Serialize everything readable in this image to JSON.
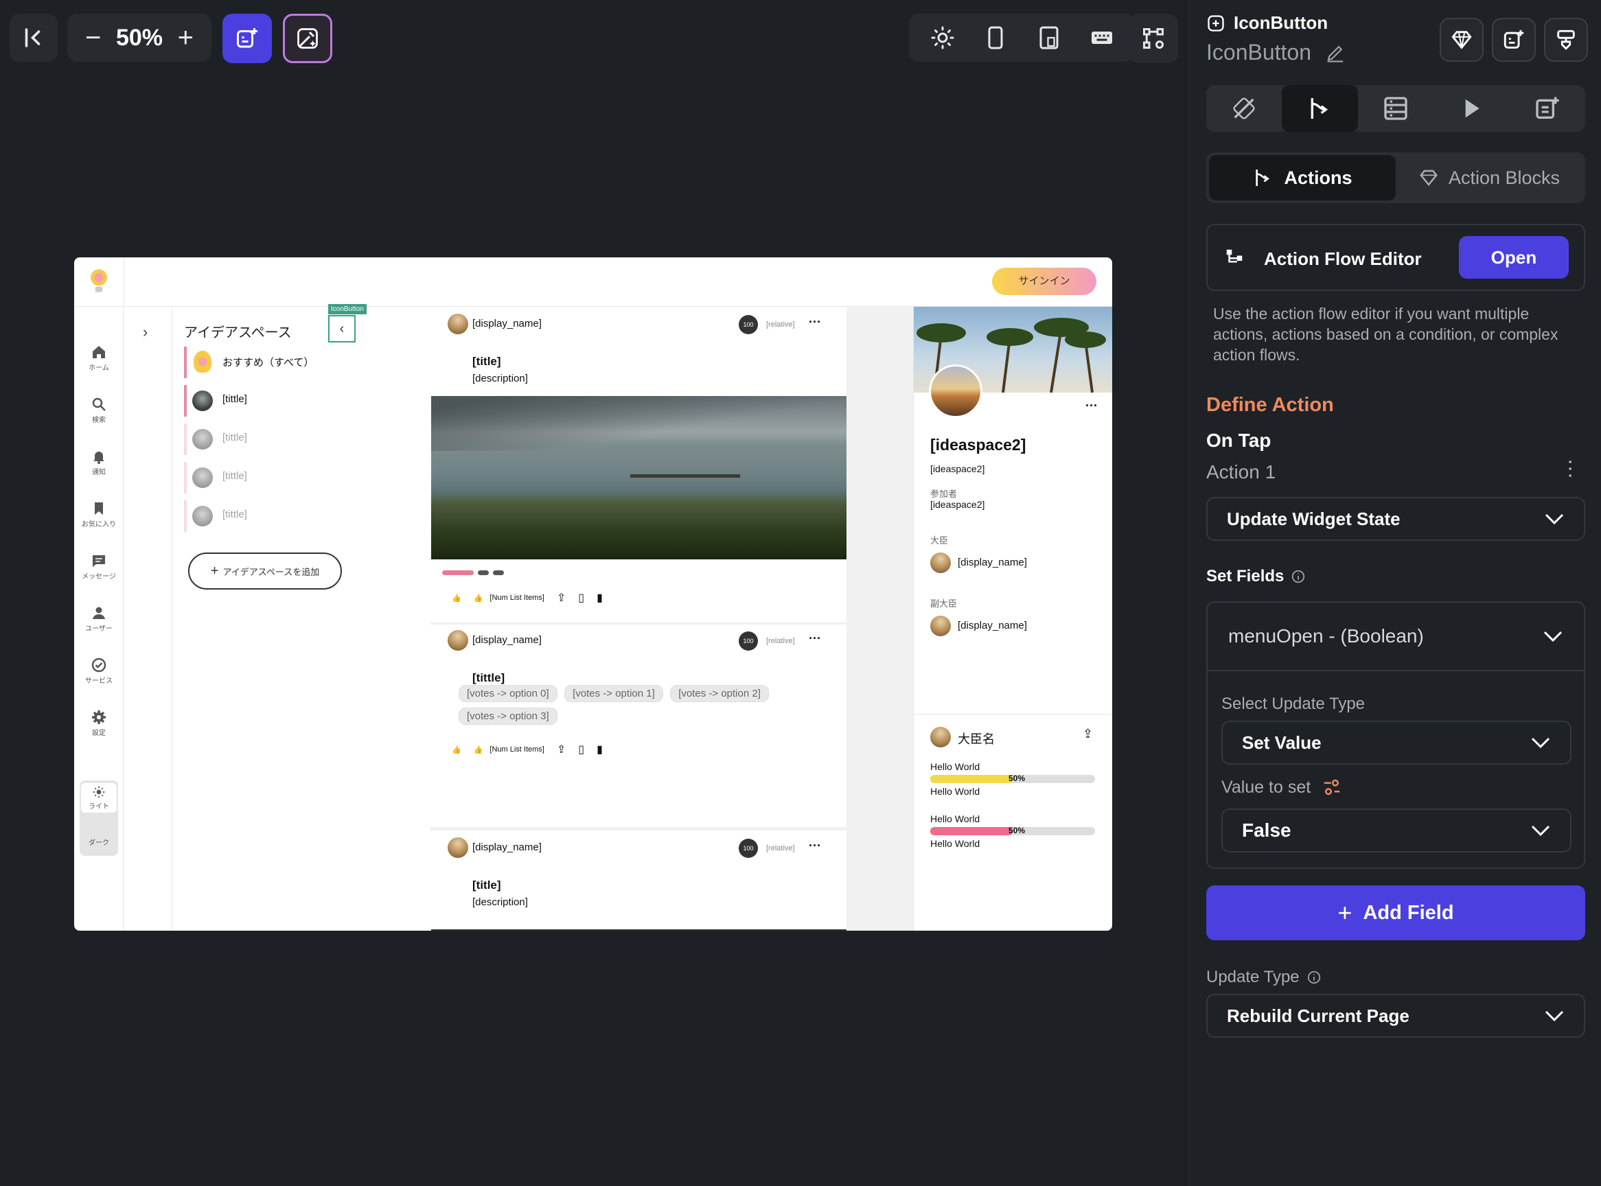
{
  "toolbar": {
    "zoom_level": "50%",
    "zoom_out": "−",
    "zoom_in": "+"
  },
  "panel": {
    "widget_type": "IconButton",
    "widget_name": "IconButton",
    "tab_actions": "Actions",
    "tab_action_blocks": "Action Blocks",
    "flow_editor_title": "Action Flow Editor",
    "flow_editor_open": "Open",
    "flow_editor_help": "Use the action flow editor if you want multiple actions, actions based on a condition, or complex action flows.",
    "define_action": "Define Action",
    "trigger": "On Tap",
    "action_label": "Action 1",
    "action_type": "Update Widget State",
    "set_fields": "Set Fields",
    "field_name": "menuOpen - (Boolean)",
    "select_update_type": "Select Update Type",
    "update_type_value": "Set Value",
    "value_to_set": "Value to set",
    "value": "False",
    "add_field": "Add Field",
    "update_type_label": "Update Type",
    "update_type": "Rebuild Current Page",
    "accent": "#4c3fe0",
    "define_color": "#f08a5d"
  },
  "app": {
    "signin": "サインイン",
    "nav": [
      "ホーム",
      "検索",
      "通知",
      "お気に入り",
      "メッセージ",
      "ユーザー",
      "サービス",
      "設定"
    ],
    "theme_light": "ライト",
    "theme_dark": "ダーク",
    "space_header": "アイデアスペース",
    "iconbutton_tag": "IconButton",
    "space_items": [
      "おすすめ（すべて）",
      "[tittle]",
      "[tittle]",
      "[tittle]",
      "[tittle]"
    ],
    "add_space": "アイデアスペースを追加",
    "posts": [
      {
        "name": "[display_name]",
        "avatar_badge": "100",
        "time": "[relative]",
        "title": "[title]",
        "desc": "[description]",
        "count": "[Num List Items]"
      },
      {
        "name": "[display_name]",
        "avatar_badge": "100",
        "time": "[relative]",
        "title": "[tittle]",
        "votes": [
          "[votes -> option 0]",
          "[votes -> option 1]",
          "[votes -> option 2]",
          "[votes -> option 3]"
        ],
        "count": "[Num List Items]"
      },
      {
        "name": "[display_name]",
        "avatar_badge": "100",
        "time": "[relative]",
        "title": "[title]",
        "desc": "[description]"
      }
    ],
    "profile": {
      "name": "[ideaspace2]",
      "sub": "[ideaspace2]",
      "members_label": "参加者",
      "members_value": "[ideaspace2]",
      "minister_label": "大臣",
      "minister_name": "[display_name]",
      "vice_label": "副大臣",
      "vice_name": "[display_name]",
      "card_title": "大臣名",
      "bars": [
        {
          "label": "Hello World",
          "pct_text": "50%",
          "pct": 0.5,
          "color": "#f2d94a",
          "below": "Hello World"
        },
        {
          "label": "Hello World",
          "pct_text": "50%",
          "pct": 0.5,
          "color": "#ee6b8b",
          "below": "Hello World"
        }
      ]
    }
  }
}
